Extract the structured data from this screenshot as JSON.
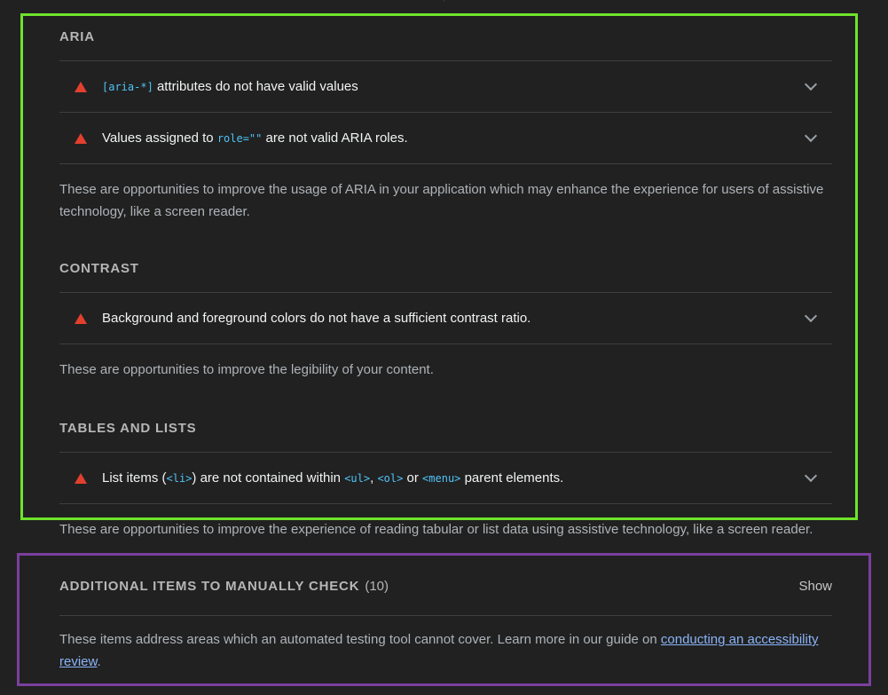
{
  "groups": [
    {
      "title": "ARIA",
      "audits": [
        {
          "segments": [
            {
              "code": "[aria-*]"
            },
            {
              "text": " attributes do not have valid values"
            }
          ]
        },
        {
          "segments": [
            {
              "text": "Values assigned to "
            },
            {
              "code": "role=\"\""
            },
            {
              "text": " are not valid ARIA roles."
            }
          ]
        }
      ],
      "description": "These are opportunities to improve the usage of ARIA in your application which may enhance the experience for users of assistive technology, like a screen reader."
    },
    {
      "title": "CONTRAST",
      "audits": [
        {
          "segments": [
            {
              "text": "Background and foreground colors do not have a sufficient contrast ratio."
            }
          ]
        }
      ],
      "description": "These are opportunities to improve the legibility of your content."
    },
    {
      "title": "TABLES AND LISTS",
      "audits": [
        {
          "segments": [
            {
              "text": "List items ("
            },
            {
              "code": "<li>"
            },
            {
              "text": ") are not contained within "
            },
            {
              "code": "<ul>"
            },
            {
              "text": ", "
            },
            {
              "code": "<ol>"
            },
            {
              "text": " or "
            },
            {
              "code": "<menu>"
            },
            {
              "text": " parent elements."
            }
          ]
        }
      ],
      "description": "These are opportunities to improve the experience of reading tabular or list data using assistive technology, like a screen reader."
    }
  ],
  "manual": {
    "title": "ADDITIONAL ITEMS TO MANUALLY CHECK",
    "count": "(10)",
    "show_label": "Show",
    "description_prefix": "These items address areas which an automated testing tool cannot cover. Learn more in our guide on ",
    "link_text": "conducting an accessibility review",
    "description_suffix": "."
  },
  "colors": {
    "fail": "#e2402e",
    "code": "#4fc3f7",
    "highlight_green": "#6ee32b",
    "highlight_purple": "#7b3f9e",
    "link": "#8ab4f8"
  }
}
